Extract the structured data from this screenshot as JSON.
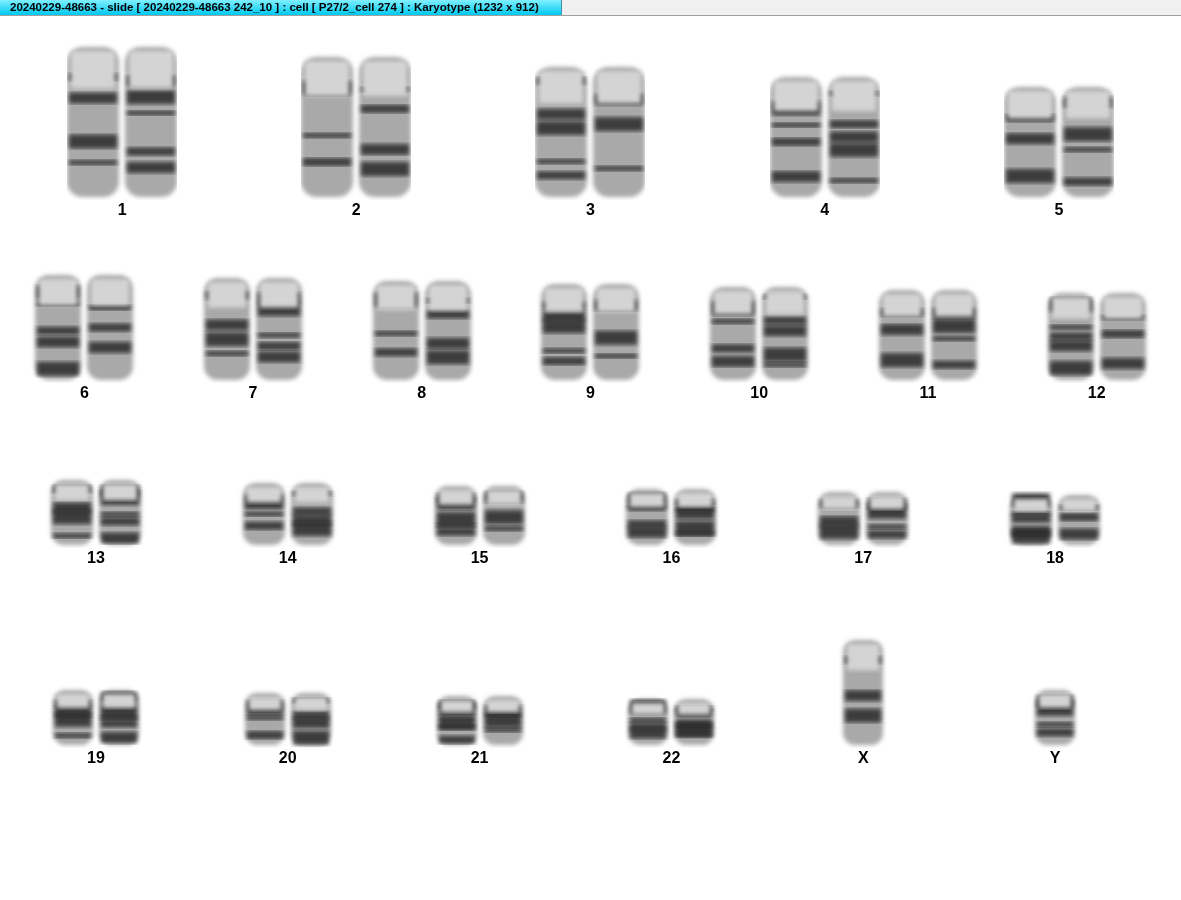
{
  "window": {
    "title": "20240229-48663 - slide [ 20240229-48663 242_10 ] : cell [ P27/2_cell 274 ] : Karyotype  (1232 x 912)"
  },
  "karyotype_rows": [
    {
      "items": [
        {
          "label": "1",
          "kind": "pair"
        },
        {
          "label": "2",
          "kind": "pair"
        },
        {
          "label": "3",
          "kind": "pair"
        },
        {
          "label": "4",
          "kind": "pair"
        },
        {
          "label": "5",
          "kind": "pair"
        }
      ]
    },
    {
      "items": [
        {
          "label": "6",
          "kind": "pair"
        },
        {
          "label": "7",
          "kind": "pair"
        },
        {
          "label": "8",
          "kind": "pair"
        },
        {
          "label": "9",
          "kind": "pair"
        },
        {
          "label": "10",
          "kind": "pair"
        },
        {
          "label": "11",
          "kind": "pair"
        },
        {
          "label": "12",
          "kind": "pair"
        }
      ]
    },
    {
      "items": [
        {
          "label": "13",
          "kind": "pair"
        },
        {
          "label": "14",
          "kind": "pair"
        },
        {
          "label": "15",
          "kind": "pair"
        },
        {
          "label": "16",
          "kind": "pair"
        },
        {
          "label": "17",
          "kind": "pair"
        },
        {
          "label": "18",
          "kind": "pair"
        }
      ]
    },
    {
      "items": [
        {
          "label": "19",
          "kind": "pair"
        },
        {
          "label": "20",
          "kind": "pair"
        },
        {
          "label": "21",
          "kind": "pair"
        },
        {
          "label": "22",
          "kind": "pair"
        },
        {
          "label": "X",
          "kind": "single"
        },
        {
          "label": "Y",
          "kind": "single"
        }
      ]
    }
  ]
}
